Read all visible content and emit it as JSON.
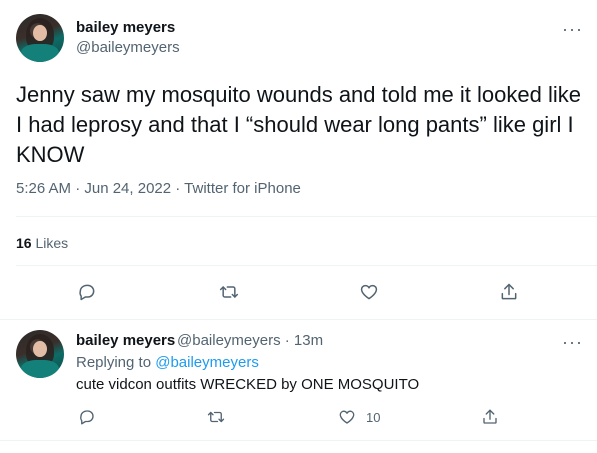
{
  "tweet": {
    "display_name": "bailey meyers",
    "handle": "@baileymeyers",
    "text": "Jenny saw my mosquito wounds and told me it looked like I had leprosy and that I “should wear long pants” like girl I KNOW",
    "timestamp": "5:26 AM · Jun 24, 2022 · Twitter for iPhone",
    "likes_count": "16",
    "likes_label": "Likes",
    "more_label": "···"
  },
  "reply": {
    "display_name": "bailey meyers",
    "handle_time": "@baileymeyers · 13m",
    "replying_prefix": "Replying to ",
    "replying_handle": "@baileymeyers",
    "text": "cute vidcon outfits WRECKED by ONE MOSQUITO",
    "like_count": "10",
    "more_label": "···"
  },
  "icons": {
    "reply": "reply-icon",
    "retweet": "retweet-icon",
    "like": "heart-icon",
    "share": "share-icon"
  },
  "colors": {
    "text": "#0f1419",
    "secondary": "#536471",
    "link": "#1d9bf0",
    "divider": "#eff3f4"
  }
}
